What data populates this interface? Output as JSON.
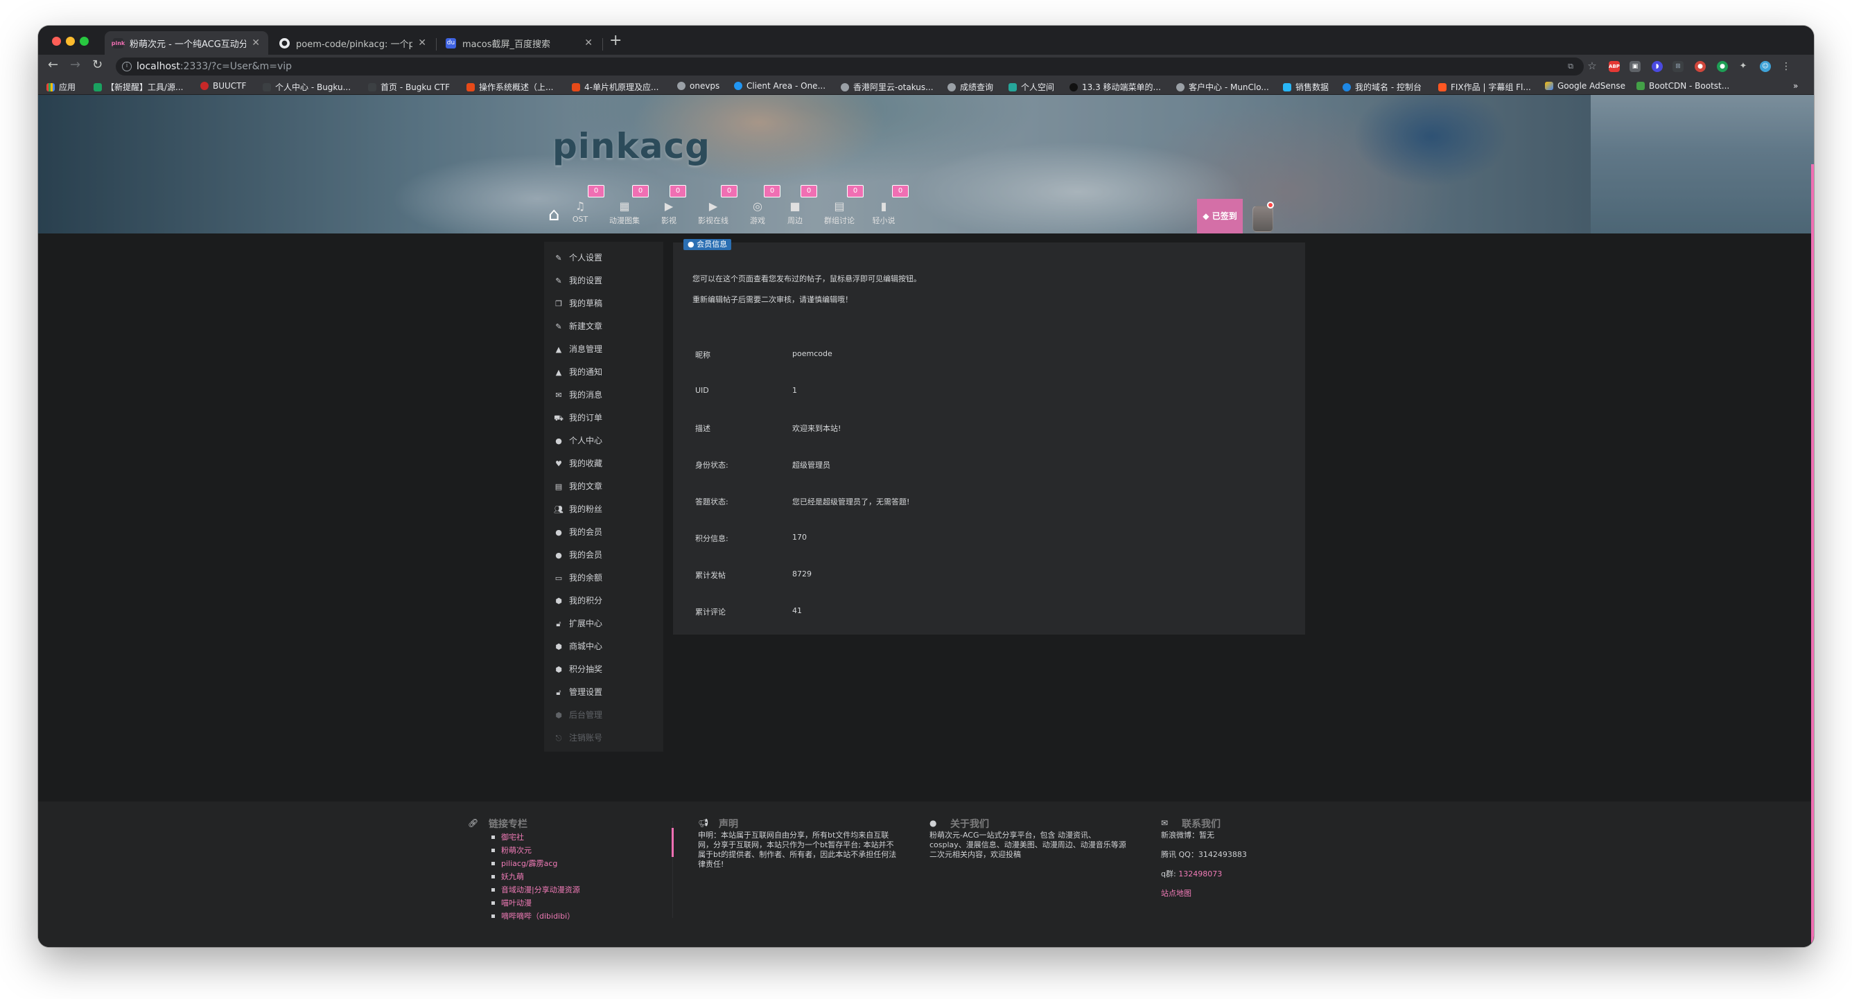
{
  "browser": {
    "tabs": [
      {
        "title": "粉萌次元 - 一个纯ACG互动分享",
        "favicon": "pink",
        "active": true
      },
      {
        "title": "poem-code/pinkacg: 一个php",
        "favicon": "github-icon",
        "active": false
      },
      {
        "title": "macos截屏_百度搜索",
        "favicon": "baidu-icon",
        "active": false
      }
    ],
    "address": {
      "host": "localhost",
      "path": ":2333/?c=User&m=vip"
    },
    "bookmarks": [
      "应用",
      "【新提醒】工具/源...",
      "BUUCTF",
      "个人中心 - Bugku...",
      "首页 - Bugku CTF",
      "操作系统概述（上...",
      "4-单片机原理及应...",
      "onevps",
      "Client Area - One...",
      "香港阿里云-otakus...",
      "成绩查询",
      "个人空间",
      "13.3 移动端菜单的...",
      "客户中心 - MunClo...",
      "销售数据",
      "我的域名 - 控制台",
      "FIX作品 | 字幕组 Fl...",
      "Google AdSense",
      "BootCDN - Bootst..."
    ],
    "more_bookmarks": "»"
  },
  "site": {
    "logo": "pinkacg",
    "menu": [
      {
        "label": "OST",
        "badge": "0",
        "icon": "music-icon"
      },
      {
        "label": "动漫图集",
        "badge": "0",
        "icon": "gallery-icon"
      },
      {
        "label": "影视",
        "badge": "0",
        "icon": "video-icon"
      },
      {
        "label": "影视在线",
        "badge": "0",
        "icon": "video-online-icon"
      },
      {
        "label": "游戏",
        "badge": "0",
        "icon": "game-icon"
      },
      {
        "label": "周边",
        "badge": "0",
        "icon": "camera-icon"
      },
      {
        "label": "群组讨论",
        "badge": "0",
        "icon": "chat-icon"
      },
      {
        "label": "轻小说",
        "badge": "0",
        "icon": "book-icon"
      }
    ],
    "signed_in": "已签到"
  },
  "sidebar": {
    "items": [
      {
        "label": "个人设置",
        "dim": false
      },
      {
        "label": "我的设置",
        "dim": false
      },
      {
        "label": "我的草稿",
        "dim": false
      },
      {
        "label": "新建文章",
        "dim": false
      },
      {
        "label": "消息管理",
        "dim": false
      },
      {
        "label": "我的通知",
        "dim": false
      },
      {
        "label": "我的消息",
        "dim": false
      },
      {
        "label": "我的订单",
        "dim": false
      },
      {
        "label": "个人中心",
        "dim": false
      },
      {
        "label": "我的收藏",
        "dim": false
      },
      {
        "label": "我的文章",
        "dim": false
      },
      {
        "label": "我的粉丝",
        "dim": false
      },
      {
        "label": "我的会员",
        "dim": false
      },
      {
        "label": "我的会员",
        "dim": false
      },
      {
        "label": "我的余额",
        "dim": false
      },
      {
        "label": "我的积分",
        "dim": false
      },
      {
        "label": "扩展中心",
        "dim": false
      },
      {
        "label": "商城中心",
        "dim": false
      },
      {
        "label": "积分抽奖",
        "dim": false
      },
      {
        "label": "管理设置",
        "dim": false
      },
      {
        "label": "后台管理",
        "dim": true
      },
      {
        "label": "注销账号",
        "dim": true
      }
    ]
  },
  "card": {
    "tag": "会员信息",
    "note1": "您可以在这个页面查看您发布过的帖子，鼠标悬浮即可见编辑按钮。",
    "note2": "重新编辑帖子后需要二次审核，请谨慎编辑哦！",
    "rows": [
      {
        "k": "昵称",
        "v": "poemcode"
      },
      {
        "k": "UID",
        "v": "1"
      },
      {
        "k": "描述",
        "v": "欢迎来到本站!"
      },
      {
        "k": "身份状态:",
        "v": "超级管理员"
      },
      {
        "k": "答题状态:",
        "v": "您已经是超级管理员了，无需答题!"
      },
      {
        "k": "积分信息:",
        "v": "170"
      },
      {
        "k": "累计发帖",
        "v": "8729"
      },
      {
        "k": "累计评论",
        "v": "41"
      }
    ]
  },
  "footer": {
    "links_title": "链接专栏",
    "links": [
      "御宅社",
      "粉萌次元",
      "piliacg/霹雳acg",
      "妖九萌",
      "音域动漫|分享动漫资源",
      "喵叶动漫",
      "嘀哔嘀哔（dibidibi）"
    ],
    "statement_title": "声明",
    "statement": "申明：本站属于互联网自由分享，所有bt文件均来自互联网，分享于互联网，本站只作为一个bt暂存平台; 本站并不属于bt的提供者、制作者、所有者，因此本站不承担任何法律责任!",
    "about_title": "关于我们",
    "about": "粉萌次元-ACG一站式分享平台，包含 动漫资讯、cosplay、漫展信息、动漫美图、动漫周边、动漫音乐等源二次元相关内容，欢迎投稿",
    "contact_title": "联系我们",
    "weibo": "新浪微博：暂无",
    "qq_label": "腾讯 QQ：",
    "qq": "3142493883",
    "qgroup_label": "q群:",
    "qgroup": "132498073",
    "sitemap": "站点地图"
  }
}
